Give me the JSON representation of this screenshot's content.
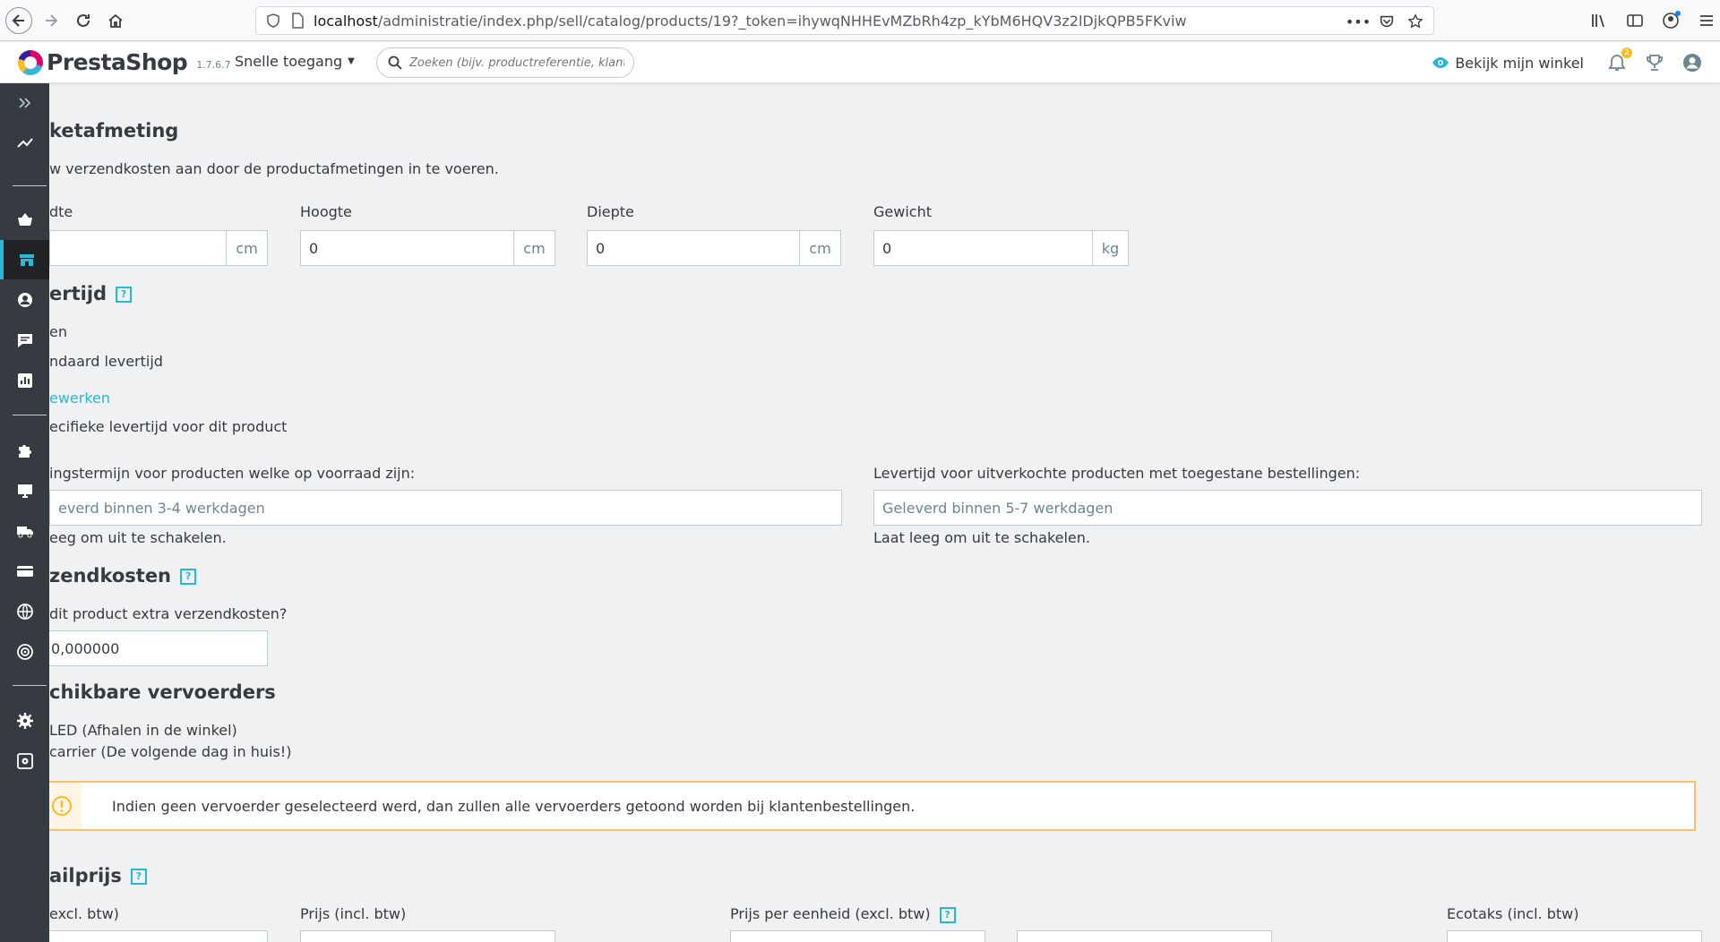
{
  "browser": {
    "url_host": "localhost",
    "url_path": "/administratie/index.php/sell/catalog/products/19?_token=ihywqNHHEvMZbRh4zp_kYbM6HQV3z2lDjkQPB5FKviw"
  },
  "header": {
    "logo": "PrestaShop",
    "version": "1.7.6.7",
    "quick_access": "Snelle toegang",
    "search_placeholder": "Zoeken (bijv. productreferentie, klantnaam...)",
    "view_shop": "Bekijk mijn winkel",
    "notifications_count": "2"
  },
  "package": {
    "title": "ketafmeting",
    "description": "w verzendkosten aan door de productafmetingen in te voeren.",
    "fields": [
      {
        "label": "dte",
        "value": "",
        "unit": "cm"
      },
      {
        "label": "Hoogte",
        "value": "0",
        "unit": "cm"
      },
      {
        "label": "Diepte",
        "value": "0",
        "unit": "cm"
      },
      {
        "label": "Gewicht",
        "value": "0",
        "unit": "kg"
      }
    ]
  },
  "delivery": {
    "title": "ertijd",
    "option_none": "en",
    "option_default": "ndaard levertijd",
    "edit_link": "ewerken",
    "option_specific": "ecifieke levertijd voor dit product",
    "in_stock_label": "ingstermijn voor producten welke op voorraad zijn:",
    "in_stock_placeholder": "everd binnen 3-4 werkdagen",
    "in_stock_hint": "eeg om uit te schakelen.",
    "out_stock_label": "Levertijd voor uitverkochte producten met toegestane bestellingen:",
    "out_stock_placeholder": "Geleverd binnen 5-7 werkdagen",
    "out_stock_hint": "Laat leeg om uit te schakelen."
  },
  "shipping": {
    "title": "zendkosten",
    "question": "dit product extra verzendkosten?",
    "value": "0,000000"
  },
  "carriers": {
    "title": "chikbare vervoerders",
    "items": [
      "LED (Afhalen in de winkel)",
      "carrier (De volgende dag in huis!)"
    ],
    "alert": "Indien geen vervoerder geselecteerd werd, dan zullen alle vervoerders getoond worden bij klantenbestellingen."
  },
  "retail": {
    "title": "ailprijs",
    "labels": [
      "excl. btw)",
      "Prijs (incl. btw)",
      "Prijs per eenheid (excl. btw)",
      "Ecotaks (incl. btw)"
    ]
  }
}
